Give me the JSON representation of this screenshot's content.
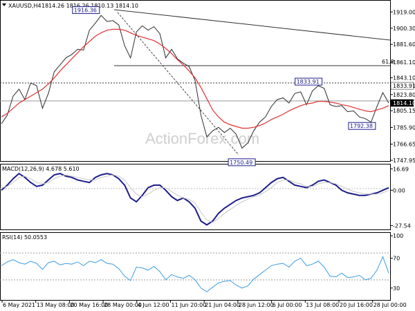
{
  "header": {
    "symbol": "XAUUSD,H4",
    "ohlc": "1814.26 1816.26 1810.13 1814.10"
  },
  "watermark": "ActionForex.com",
  "chart_data": [
    {
      "type": "line",
      "panel": "price",
      "ylim": [
        1747.95,
        1928.0
      ],
      "yticks": [
        "1919.00",
        "1900.30",
        "1881.60",
        "1861.10",
        "1843.10",
        "1823.80",
        "1805.15",
        "1785.90",
        "1766.65",
        "1747.95"
      ],
      "xticks": [
        "6 May 2021",
        "13 May 08:00",
        "20 May 16:00",
        "28 May 00:00",
        "4 Jun 12:00",
        "11 Jun 20:00",
        "21 Jun 04:00",
        "28 Jun 12:00",
        "6 Jul 00:00",
        "13 Jul 08:00",
        "20 Jul 16:00",
        "28 Jul 00:00"
      ],
      "x_start": "2021-05-06",
      "x_end": "2021-08-01",
      "series": [
        {
          "color": "#2b2b2b",
          "values": [
            1790,
            1800,
            1822,
            1830,
            1818,
            1837,
            1834,
            1808,
            1825,
            1850,
            1858,
            1866,
            1870,
            1876,
            1875,
            1898,
            1906,
            1915,
            1908,
            1909,
            1904,
            1880,
            1866,
            1896,
            1903,
            1898,
            1902,
            1894,
            1866,
            1876,
            1865,
            1860,
            1856,
            1840,
            1800,
            1775,
            1782,
            1786,
            1780,
            1785,
            1778,
            1762,
            1768,
            1782,
            1792,
            1798,
            1810,
            1818,
            1820,
            1814,
            1825,
            1827,
            1812,
            1828,
            1834,
            1831,
            1812,
            1810,
            1811,
            1804,
            1805,
            1798,
            1796,
            1792,
            1810,
            1826,
            1814
          ]
        },
        {
          "color": "#e03030",
          "values": [
            1798,
            1802,
            1808,
            1814,
            1818,
            1822,
            1826,
            1830,
            1836,
            1843,
            1851,
            1858,
            1865,
            1872,
            1879,
            1885,
            1891,
            1895,
            1898,
            1899,
            1899,
            1898,
            1895,
            1892,
            1890,
            1888,
            1886,
            1882,
            1877,
            1871,
            1864,
            1858,
            1851,
            1843,
            1832,
            1819,
            1806,
            1798,
            1792,
            1789,
            1787,
            1785,
            1785,
            1786,
            1788,
            1791,
            1795,
            1798,
            1801,
            1805,
            1808,
            1811,
            1813,
            1814,
            1816,
            1816,
            1815,
            1814,
            1812,
            1811,
            1809,
            1807,
            1805,
            1804,
            1806,
            1808,
            1811
          ]
        }
      ],
      "labels": [
        {
          "text": "1916.36",
          "x": "2021-05-25",
          "y": 1916.36
        },
        {
          "text": "1750.49",
          "x": "2021-06-29",
          "y": 1750.49
        },
        {
          "text": "1833.91",
          "x": "2021-07-14",
          "y": 1833.91
        },
        {
          "text": "1792.38",
          "x": "2021-07-26",
          "y": 1792.38
        }
      ],
      "fib_label": "61.8",
      "right_tags": [
        {
          "text": "1833.91",
          "bg": "#ffffff",
          "fg": "#000000"
        },
        {
          "text": "1814.10",
          "bg": "#000000",
          "fg": "#ffffff"
        }
      ]
    },
    {
      "type": "line",
      "panel": "macd",
      "title": "MACD(12,26,9) 4.678 5.610",
      "ylim": [
        -30.0,
        19.0
      ],
      "yticks": [
        "16.69",
        "0.00",
        "-27.54"
      ],
      "series": [
        {
          "color": "#1c1c8c",
          "values": [
            0,
            4,
            9,
            13,
            10,
            6,
            3,
            4,
            8,
            12,
            13,
            11,
            10,
            8,
            7,
            6,
            10,
            12,
            13,
            12,
            9,
            4,
            -6,
            -9,
            -4,
            2,
            4,
            4,
            0,
            -5,
            -8,
            -6,
            -9,
            -14,
            -24,
            -27,
            -24,
            -18,
            -14,
            -11,
            -8,
            -6,
            -5,
            -4,
            -2,
            2,
            6,
            9,
            10,
            7,
            4,
            3,
            2,
            4,
            7,
            8,
            6,
            4,
            0,
            -2,
            -3,
            -4,
            -4,
            -3,
            -2,
            0,
            2
          ]
        },
        {
          "color": "#c8c8c8",
          "values": [
            2,
            3,
            6,
            10,
            11,
            9,
            6,
            5,
            6,
            9,
            11,
            12,
            11,
            10,
            9,
            8,
            8,
            10,
            11,
            12,
            11,
            8,
            2,
            -3,
            -5,
            -3,
            0,
            2,
            2,
            -1,
            -4,
            -6,
            -7,
            -10,
            -17,
            -23,
            -25,
            -22,
            -18,
            -15,
            -12,
            -9,
            -7,
            -5,
            -4,
            -1,
            2,
            6,
            8,
            8,
            6,
            5,
            3,
            3,
            5,
            6,
            6,
            5,
            3,
            1,
            -1,
            -2,
            -3,
            -3,
            -3,
            -2,
            0
          ]
        }
      ]
    },
    {
      "type": "line",
      "panel": "rsi",
      "title": "RSI(14) 50.0553",
      "ylim": [
        15,
        102
      ],
      "yticks": [
        "100",
        "70",
        "30",
        "0"
      ],
      "series": [
        {
          "color": "#3a9de0",
          "values": [
            60,
            65,
            68,
            64,
            62,
            66,
            63,
            55,
            64,
            66,
            61,
            63,
            62,
            65,
            60,
            66,
            64,
            68,
            63,
            62,
            56,
            46,
            40,
            58,
            57,
            54,
            59,
            52,
            41,
            48,
            45,
            43,
            47,
            41,
            30,
            25,
            31,
            37,
            39,
            40,
            34,
            30,
            33,
            42,
            48,
            54,
            60,
            62,
            63,
            58,
            66,
            70,
            60,
            62,
            66,
            58,
            46,
            45,
            50,
            44,
            45,
            47,
            41,
            43,
            54,
            72,
            50
          ]
        }
      ]
    }
  ]
}
